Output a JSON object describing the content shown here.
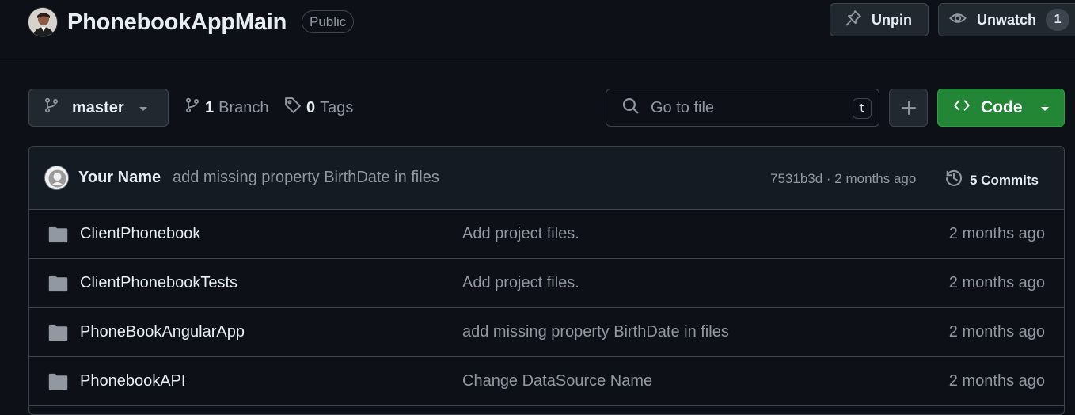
{
  "header": {
    "repo_name": "PhonebookAppMain",
    "visibility": "Public",
    "unpin_label": "Unpin",
    "unwatch_label": "Unwatch",
    "watch_count": "1"
  },
  "toolbar": {
    "branch": "master",
    "branch_count": "1",
    "branch_label": "Branch",
    "tag_count": "0",
    "tag_label": "Tags",
    "search_placeholder": "Go to file",
    "search_shortcut": "t",
    "code_label": "Code"
  },
  "latest_commit": {
    "author": "Your Name",
    "message": "add missing property BirthDate in files",
    "meta": "7531b3d · 2 months ago",
    "commits_label": "5 Commits"
  },
  "files": [
    {
      "name": "ClientPhonebook",
      "message": "Add project files.",
      "date": "2 months ago"
    },
    {
      "name": "ClientPhonebookTests",
      "message": "Add project files.",
      "date": "2 months ago"
    },
    {
      "name": "PhoneBookAngularApp",
      "message": "add missing property BirthDate in files",
      "date": "2 months ago"
    },
    {
      "name": "PhonebookAPI",
      "message": "Change DataSource Name",
      "date": "2 months ago"
    }
  ],
  "colors": {
    "background": "#0d1117",
    "border": "#3d444d",
    "code_button": "#238636",
    "folder_icon": "#9198a1"
  },
  "icons": {
    "pin": "pin-icon",
    "eye": "eye-icon",
    "branch": "git-branch-icon",
    "tag": "tag-icon",
    "search": "search-icon",
    "plus": "plus-icon",
    "code": "code-icon",
    "history": "history-icon",
    "folder": "folder-icon"
  }
}
